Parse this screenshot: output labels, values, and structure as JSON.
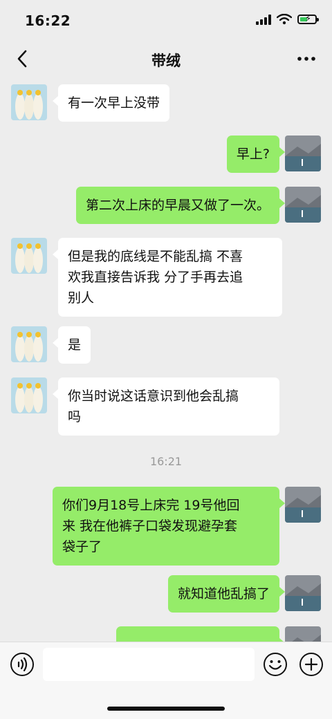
{
  "status": {
    "time": "16:22"
  },
  "header": {
    "title": "带绒",
    "back_icon": "chevron-left-icon",
    "more_icon": "more-dots-icon"
  },
  "messages": [
    {
      "side": "in",
      "text": "有一次早上没带"
    },
    {
      "side": "out",
      "text": "早上?"
    },
    {
      "side": "out",
      "text": "第二次上床的早晨又做了一次。"
    },
    {
      "side": "in",
      "line1": "但是我的底线是不能乱搞 不喜",
      "line2": "欢我直接告诉我 分了手再去追",
      "line3": "别人"
    },
    {
      "side": "in",
      "text": "是"
    },
    {
      "side": "in",
      "line1": "你当时说这话意识到他会乱搞",
      "line2": "吗"
    },
    {
      "side": "out",
      "line1": "你们9月18号上床完 19号他回",
      "line2": "来 我在他裤子口袋发现避孕套",
      "line3": "袋子了"
    },
    {
      "side": "out",
      "text": "就知道他乱搞了"
    }
  ],
  "timestamp": "16:21",
  "input": {
    "value": "",
    "voice_icon": "voice-icon",
    "emoji_icon": "emoji-icon",
    "plus_icon": "plus-icon"
  },
  "colors": {
    "background": "#ededed",
    "outgoing_bubble": "#95ec69",
    "incoming_bubble": "#ffffff",
    "timestamp": "#999999"
  }
}
